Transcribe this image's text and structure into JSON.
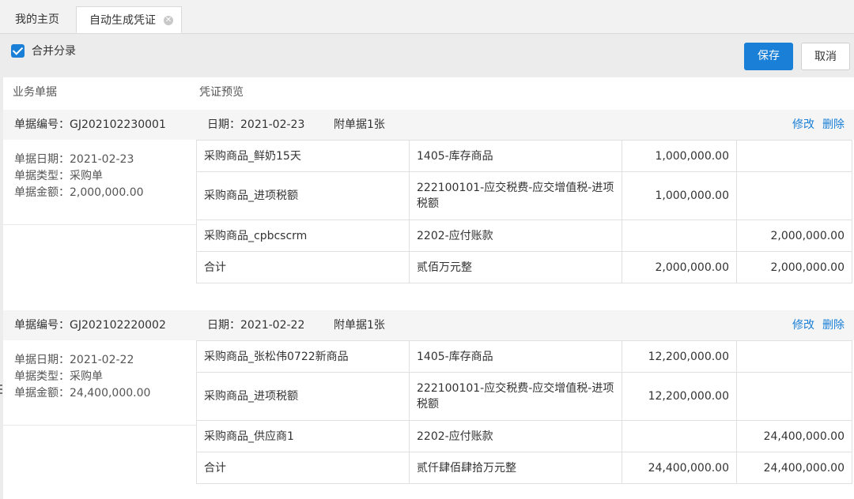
{
  "tabs": [
    {
      "label": "我的主页",
      "active": false
    },
    {
      "label": "自动生成凭证",
      "active": true
    }
  ],
  "toolbar": {
    "merge_label": "合并分录",
    "merge_checked": true,
    "save_label": "保存",
    "cancel_label": "取消"
  },
  "columns": {
    "left": "业务单据",
    "right": "凭证预览"
  },
  "docs": [
    {
      "doc_no": "单据编号：GJ202102230001",
      "date_line": "单据日期：2021-02-23",
      "type_line": "单据类型：采购单",
      "amount_line": "单据金额：2,000,000.00",
      "voucher_date": "日期：2021-02-23",
      "attachments": "附单据1张",
      "edit_label": "修改",
      "delete_label": "删除",
      "rows": [
        {
          "summary": "采购商品_鲜奶15天",
          "account": "1405-库存商品",
          "debit": "1,000,000.00",
          "credit": ""
        },
        {
          "summary": "采购商品_进项税额",
          "account": "222100101-应交税费-应交增值税-进项税额",
          "debit": "1,000,000.00",
          "credit": ""
        },
        {
          "summary": "采购商品_cpbcscrm",
          "account": "2202-应付账款",
          "debit": "",
          "credit": "2,000,000.00"
        },
        {
          "summary": "合计",
          "account": "贰佰万元整",
          "debit": "2,000,000.00",
          "credit": "2,000,000.00"
        }
      ]
    },
    {
      "doc_no": "单据编号：GJ202102220002",
      "date_line": "单据日期：2021-02-22",
      "type_line": "单据类型：采购单",
      "amount_line": "单据金额：24,400,000.00",
      "voucher_date": "日期：2021-02-22",
      "attachments": "附单据1张",
      "edit_label": "修改",
      "delete_label": "删除",
      "rows": [
        {
          "summary": "采购商品_张松伟0722新商品",
          "account": "1405-库存商品",
          "debit": "12,200,000.00",
          "credit": ""
        },
        {
          "summary": "采购商品_进项税额",
          "account": "222100101-应交税费-应交增值税-进项税额",
          "debit": "12,200,000.00",
          "credit": ""
        },
        {
          "summary": "采购商品_供应商1",
          "account": "2202-应付账款",
          "debit": "",
          "credit": "24,400,000.00"
        },
        {
          "summary": "合计",
          "account": "贰仟肆佰肆拾万元整",
          "debit": "24,400,000.00",
          "credit": "24,400,000.00"
        }
      ]
    }
  ]
}
